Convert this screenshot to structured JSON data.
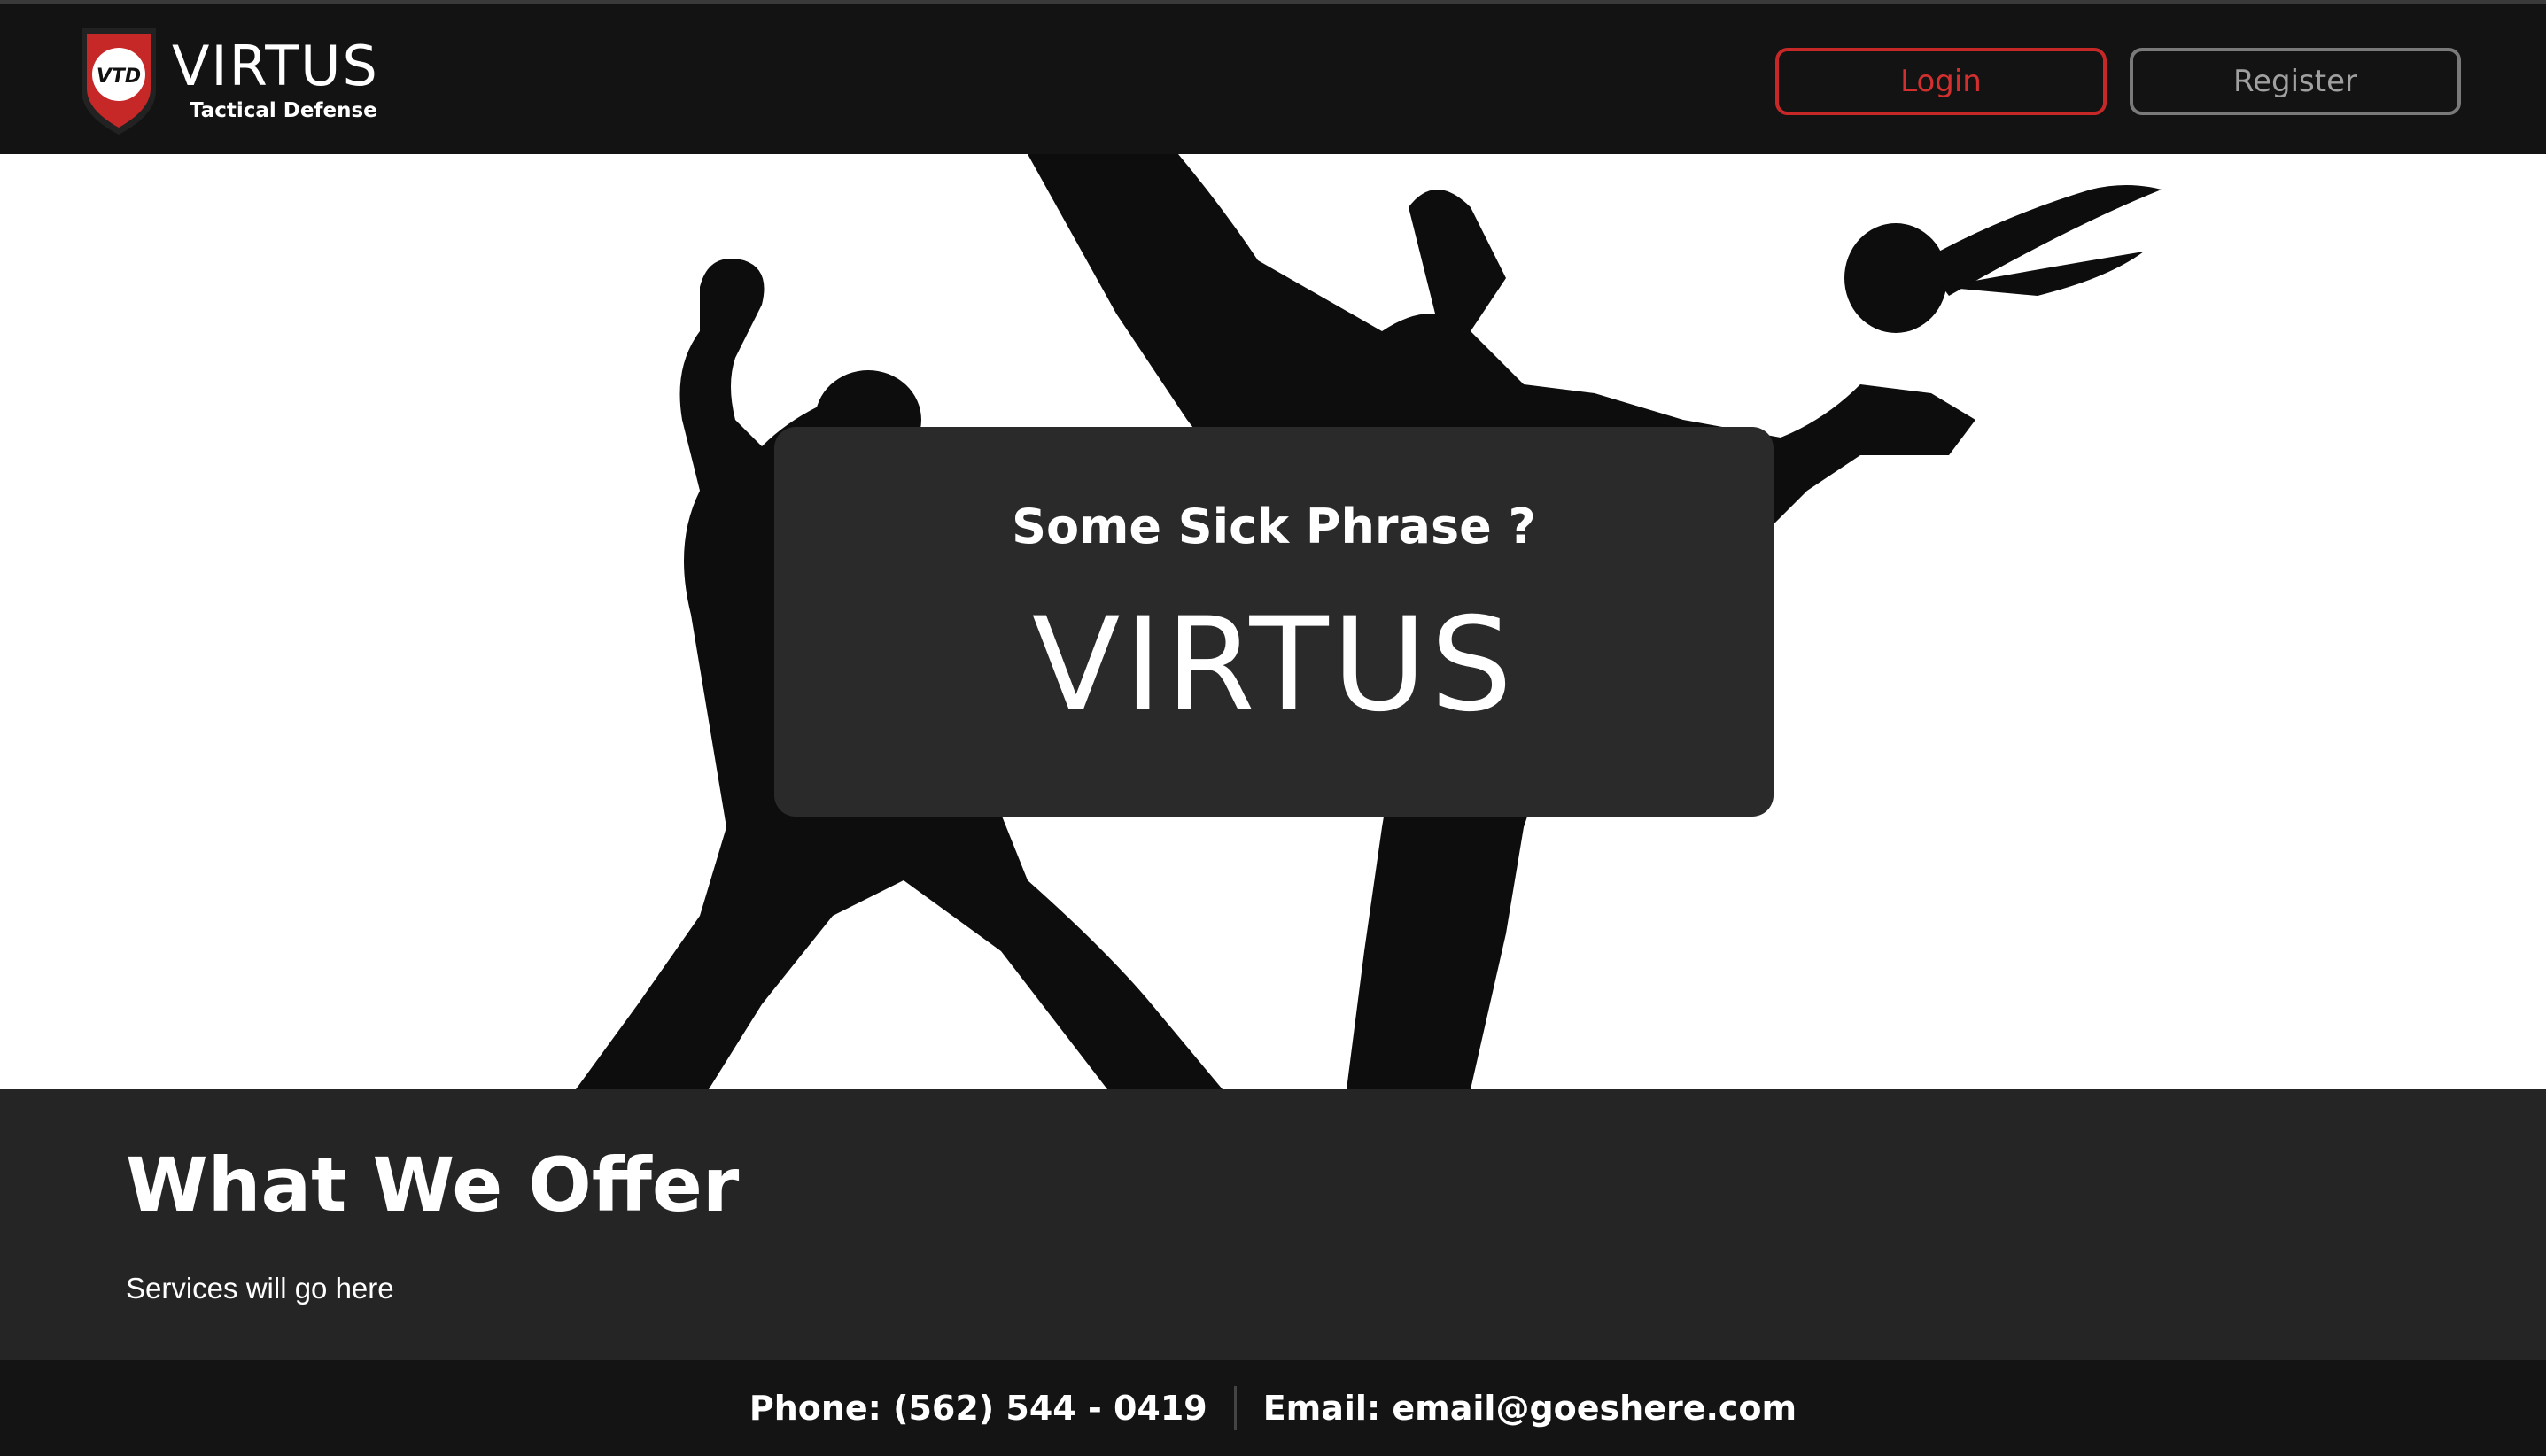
{
  "header": {
    "logo_badge": "VTD",
    "brand_name": "VIRTUS",
    "brand_tagline": "Tactical Defense",
    "login_label": "Login",
    "register_label": "Register"
  },
  "hero": {
    "phrase": "Some Sick Phrase ?",
    "title": "VIRTUS"
  },
  "offer": {
    "title": "What We Offer",
    "text": "Services will go here"
  },
  "footer": {
    "phone": "Phone: (562) 544 - 0419",
    "email": "Email: email@goeshere.com"
  },
  "colors": {
    "accent_red": "#d32f2f",
    "header_bg": "#131313",
    "section_bg": "#252525",
    "card_bg": "#2a2a2a"
  }
}
